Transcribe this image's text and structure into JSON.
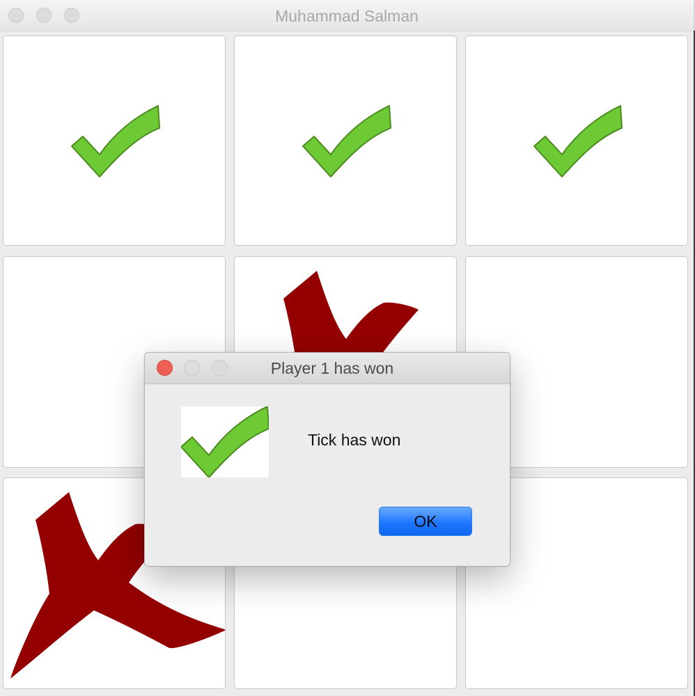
{
  "window": {
    "title": "Muhammad Salman"
  },
  "board": {
    "cells": [
      {
        "row": 1,
        "col": 1,
        "mark": "tick"
      },
      {
        "row": 1,
        "col": 2,
        "mark": "tick"
      },
      {
        "row": 1,
        "col": 3,
        "mark": "tick"
      },
      {
        "row": 2,
        "col": 1,
        "mark": "empty"
      },
      {
        "row": 2,
        "col": 2,
        "mark": "cross"
      },
      {
        "row": 2,
        "col": 3,
        "mark": "empty"
      },
      {
        "row": 3,
        "col": 1,
        "mark": "cross"
      },
      {
        "row": 3,
        "col": 2,
        "mark": "empty"
      },
      {
        "row": 3,
        "col": 3,
        "mark": "empty"
      }
    ],
    "icons": {
      "tick": "check-mark-icon",
      "cross": "cross-mark-icon"
    },
    "colors": {
      "tick_fill": "#6dc934",
      "tick_stroke": "#4b8a1f",
      "cross_fill": "#940000"
    }
  },
  "dialog": {
    "title": "Player 1 has won",
    "message": "Tick has won",
    "icon": "check-mark-icon",
    "ok_label": "OK",
    "colors": {
      "close": "#ee5f56",
      "button": "#1f77ff"
    }
  }
}
